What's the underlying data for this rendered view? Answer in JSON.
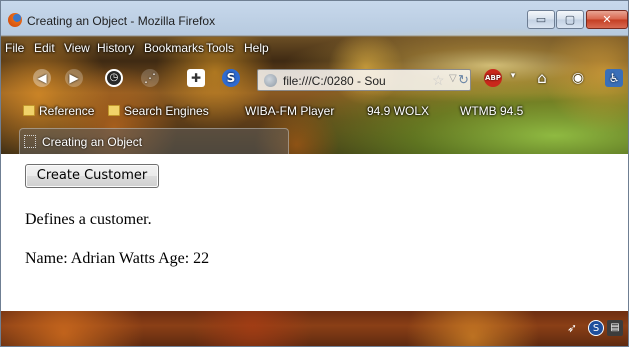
{
  "window": {
    "title": "Creating an Object - Mozilla Firefox",
    "min_glyph": "▭",
    "max_glyph": "▢",
    "close_glyph": "✕"
  },
  "menu": {
    "items": [
      "File",
      "Edit",
      "View",
      "History",
      "Bookmarks",
      "Tools",
      "Help"
    ]
  },
  "navbar": {
    "url": "file:///C:/0280 - Sou",
    "icons": [
      "back-icon",
      "forward-icon",
      "history-clock-icon",
      "rss-icon",
      "addon-icon",
      "s-icon",
      "adblock-icon",
      "home-icon",
      "eye-icon",
      "accessibility-icon"
    ],
    "adblock_label": "ABP",
    "s_label": "S"
  },
  "bookmarks": {
    "items": [
      "Reference",
      "Search Engines",
      "WIBA-FM Player",
      "94.9 WOLX",
      "WTMB 94.5"
    ]
  },
  "tab": {
    "label": "Creating an Object"
  },
  "content": {
    "button_label": "Create Customer",
    "description": "Defines a customer.",
    "info": "Name: Adrian Watts Age: 22"
  },
  "colors": {
    "close_red": "#c43d22",
    "titlebar_blue": "#c7d8ec"
  }
}
